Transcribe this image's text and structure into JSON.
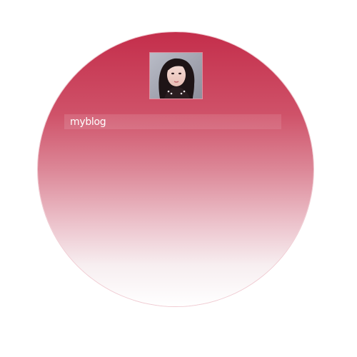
{
  "profile": {
    "avatar_icon": "profile-photo-icon"
  },
  "header": {
    "title": "myblog"
  },
  "colors": {
    "accent": "#c42e4b",
    "accent_light": "#dc8797",
    "fade": "#ffffff"
  }
}
